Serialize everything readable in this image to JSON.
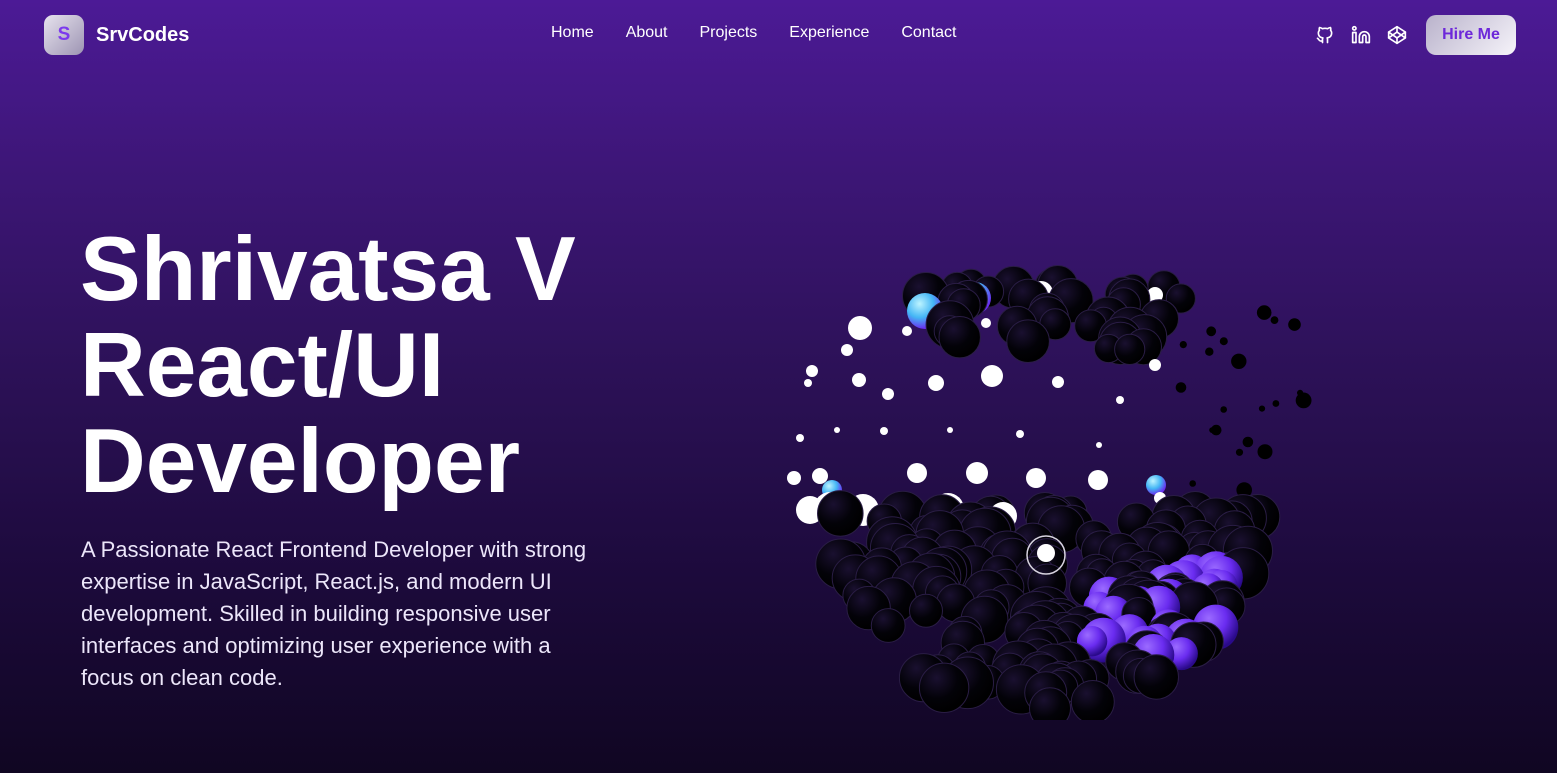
{
  "brand": {
    "logo_letter": "S",
    "name": "SrvCodes"
  },
  "nav": {
    "links": [
      "Home",
      "About",
      "Projects",
      "Experience",
      "Contact"
    ],
    "social_icons": [
      "github-icon",
      "linkedin-icon",
      "codepen-icon"
    ],
    "hire_label": "Hire Me"
  },
  "hero": {
    "title_lines": [
      "Shrivatsa V",
      "React/UI",
      "Developer"
    ],
    "description": "A Passionate React Frontend Developer with strong expertise in JavaScript, React.js, and modern UI development. Skilled in building responsive user interfaces and optimizing user experience with a focus on clean code."
  },
  "colors": {
    "accent": "#7c3aed",
    "background_top": "#4c1a96",
    "background_bottom": "#100622"
  }
}
